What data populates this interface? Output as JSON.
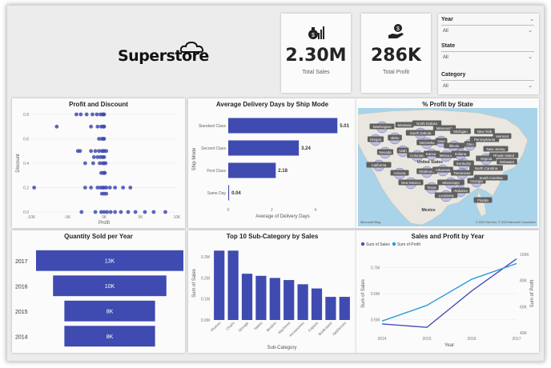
{
  "header": {
    "logo_text": "Superstore",
    "kpis": [
      {
        "value": "2.30M",
        "label": "Total Sales",
        "icon": "money-bag-chart-icon"
      },
      {
        "value": "286K",
        "label": "Total Profit",
        "icon": "hand-coin-icon"
      }
    ],
    "slicers": [
      {
        "title": "Year",
        "value": "All"
      },
      {
        "title": "State",
        "value": "All"
      },
      {
        "title": "Category",
        "value": "All"
      }
    ]
  },
  "colors": {
    "bar": "#3f4bb0",
    "series_sales": "#4a4fb6",
    "series_profit": "#2b9bdb",
    "map_water": "#a9d3e8",
    "map_land": "#e9e7df"
  },
  "map": {
    "title": "% Profit by State",
    "labels": [
      "Washington",
      "Montana",
      "North Dakota",
      "Minnesota",
      "Oregon",
      "Idaho",
      "South Dakota",
      "Michigan",
      "New York",
      "Nebraska",
      "Iowa",
      "Illinois",
      "Ohio",
      "Pennsylvania",
      "Vermont",
      "Nevada",
      "Utah",
      "Colorado",
      "Kansas",
      "Missouri",
      "Indiana",
      "New Jersey",
      "California",
      "United States",
      "Kentucky",
      "Virginia",
      "Rhode Island",
      "Arizona",
      "Oklahoma",
      "Arkansas",
      "Tennessee",
      "North Carolina",
      "Delaware",
      "New Mexico",
      "Texas",
      "Mississippi",
      "Alabama",
      "Georgia",
      "South Carolina",
      "Louisiana",
      "Florida",
      "Mexico"
    ],
    "attribution": "Microsoft Bing",
    "copyright": "© 2023 TomTom, © 2023 Microsoft Corporation"
  },
  "chart_data": [
    {
      "type": "scatter",
      "title": "Profit and Discount",
      "xlabel": "Profit",
      "ylabel": "Discount",
      "xlim": [
        -10000,
        10000
      ],
      "ylim": [
        0,
        0.8
      ],
      "x_ticks": [
        "-10K",
        "-5K",
        "0K",
        "5K",
        "10K"
      ],
      "y_ticks": [
        "0.0",
        "0.2",
        "0.4",
        "0.6",
        "0.8"
      ],
      "points": [
        [
          -3800,
          0.8
        ],
        [
          -3200,
          0.8
        ],
        [
          -2400,
          0.8
        ],
        [
          -1600,
          0.8
        ],
        [
          -1000,
          0.8
        ],
        [
          -500,
          0.8
        ],
        [
          -200,
          0.8
        ],
        [
          -100,
          0.8
        ],
        [
          0,
          0.8
        ],
        [
          -6500,
          0.7
        ],
        [
          -1800,
          0.7
        ],
        [
          -900,
          0.7
        ],
        [
          -400,
          0.7
        ],
        [
          -150,
          0.7
        ],
        [
          -50,
          0.7
        ],
        [
          0,
          0.7
        ],
        [
          -700,
          0.6
        ],
        [
          -300,
          0.6
        ],
        [
          -100,
          0.6
        ],
        [
          0,
          0.6
        ],
        [
          -3600,
          0.5
        ],
        [
          -3300,
          0.5
        ],
        [
          -1800,
          0.5
        ],
        [
          -1200,
          0.5
        ],
        [
          -700,
          0.5
        ],
        [
          -300,
          0.5
        ],
        [
          -100,
          0.5
        ],
        [
          0,
          0.5
        ],
        [
          300,
          0.5
        ],
        [
          -1400,
          0.45
        ],
        [
          -900,
          0.45
        ],
        [
          -500,
          0.45
        ],
        [
          -200,
          0.45
        ],
        [
          0,
          0.45
        ],
        [
          -2600,
          0.4
        ],
        [
          -1500,
          0.4
        ],
        [
          -600,
          0.4
        ],
        [
          -200,
          0.4
        ],
        [
          0,
          0.4
        ],
        [
          200,
          0.4
        ],
        [
          -400,
          0.32
        ],
        [
          -100,
          0.32
        ],
        [
          0,
          0.32
        ],
        [
          100,
          0.32
        ],
        [
          -9600,
          0.2
        ],
        [
          -2600,
          0.2
        ],
        [
          -1800,
          0.2
        ],
        [
          -900,
          0.2
        ],
        [
          -500,
          0.2
        ],
        [
          -200,
          0.2
        ],
        [
          0,
          0.2
        ],
        [
          300,
          0.2
        ],
        [
          800,
          0.2
        ],
        [
          1500,
          0.2
        ],
        [
          2600,
          0.2
        ],
        [
          3600,
          0.2
        ],
        [
          -300,
          0.15
        ],
        [
          0,
          0.15
        ],
        [
          300,
          0.15
        ],
        [
          -3100,
          0
        ],
        [
          -1200,
          0
        ],
        [
          -400,
          0
        ],
        [
          0,
          0
        ],
        [
          400,
          0
        ],
        [
          900,
          0
        ],
        [
          1500,
          0
        ],
        [
          2300,
          0
        ],
        [
          3300,
          0
        ],
        [
          4300,
          0
        ],
        [
          5600,
          0
        ],
        [
          6800,
          0
        ],
        [
          8400,
          0
        ]
      ]
    },
    {
      "type": "bar",
      "orientation": "horizontal",
      "title": "Average Delivery Days by Ship Mode",
      "xlabel": "Average of Delivery Days",
      "ylabel": "Ship Mode",
      "categories": [
        "Standard Class",
        "Second Class",
        "First Class",
        "Same Day"
      ],
      "values": [
        5.01,
        3.24,
        2.18,
        0.04
      ],
      "data_labels": [
        "5.01",
        "3.24",
        "2.18",
        "0.04"
      ],
      "xlim": [
        0,
        5
      ],
      "x_ticks": [
        "0",
        "2",
        "4"
      ]
    },
    {
      "type": "bar",
      "orientation": "horizontal-funnel",
      "title": "Quantity Sold per Year",
      "categories": [
        "2017",
        "2016",
        "2015",
        "2014"
      ],
      "values": [
        13000,
        10000,
        8000,
        8000
      ],
      "data_labels": [
        "13K",
        "10K",
        "8K",
        "8K"
      ]
    },
    {
      "type": "bar",
      "title": "Top 10 Sub-Category by Sales",
      "xlabel": "Sub-Category",
      "ylabel": "Sum of Sales",
      "categories": [
        "Phones",
        "Chairs",
        "Storage",
        "Tables",
        "Binders",
        "Machines",
        "Accessories",
        "Copiers",
        "Bookcases",
        "Appliances"
      ],
      "values": [
        0.33,
        0.33,
        0.22,
        0.21,
        0.2,
        0.19,
        0.17,
        0.15,
        0.11,
        0.11
      ],
      "ylim": [
        0,
        0.35
      ],
      "y_ticks": [
        "0.0M",
        "0.1M",
        "0.2M",
        "0.3M"
      ]
    },
    {
      "type": "line",
      "title": "Sales and Profit by Year",
      "xlabel": "Year",
      "ylabel": "Sum of Sales",
      "y2label": "Sum of Profit",
      "x": [
        "2014",
        "2015",
        "2016",
        "2017"
      ],
      "series": [
        {
          "name": "Sum of Sales",
          "axis": "left",
          "values": [
            0.484,
            0.471,
            0.61,
            0.733
          ]
        },
        {
          "name": "Sum of Profit",
          "axis": "right",
          "values": [
            49000,
            61000,
            81000,
            93000
          ]
        }
      ],
      "ylim": [
        0.45,
        0.75
      ],
      "y_ticks": [
        "0.5M",
        "0.6M",
        "0.7M"
      ],
      "y2lim": [
        40000,
        100000
      ],
      "y2_ticks": [
        "40K",
        "60K",
        "80K",
        "100K"
      ]
    }
  ]
}
